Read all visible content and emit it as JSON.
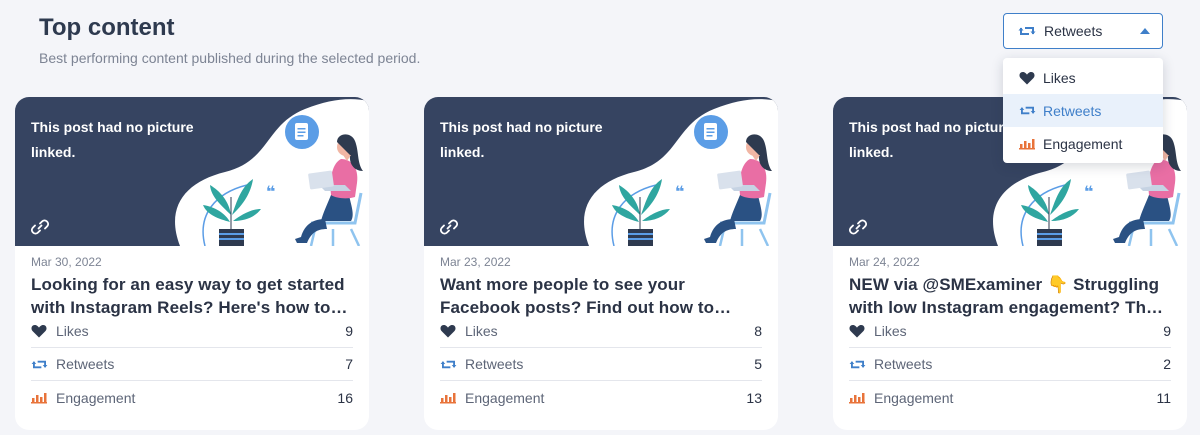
{
  "header": {
    "title": "Top content",
    "subtitle": "Best performing content published during the selected period."
  },
  "metric_select": {
    "selected": "Retweets",
    "options": [
      {
        "label": "Likes",
        "icon": "heart-icon"
      },
      {
        "label": "Retweets",
        "icon": "retweet-icon"
      },
      {
        "label": "Engagement",
        "icon": "bar-chart-icon"
      }
    ]
  },
  "colors": {
    "banner": "#364461",
    "accent_blue": "#3f7fc9",
    "engagement_orange": "#e8733a",
    "heart_navy": "#2e3a4f"
  },
  "cards": [
    {
      "banner_text": "This post had no picture linked.",
      "date": "Mar 30, 2022",
      "title_line1": "Looking for an easy way to get started",
      "title_line2": "with Instagram Reels? Here's how to…",
      "stats": [
        {
          "label": "Likes",
          "value": "9",
          "icon": "heart-icon"
        },
        {
          "label": "Retweets",
          "value": "7",
          "icon": "retweet-icon"
        },
        {
          "label": "Engagement",
          "value": "16",
          "icon": "bar-chart-icon"
        }
      ]
    },
    {
      "banner_text": "This post had no picture linked.",
      "date": "Mar 23, 2022",
      "title_line1": "Want more people to see your",
      "title_line2": "Facebook posts? Find out how to…",
      "stats": [
        {
          "label": "Likes",
          "value": "8",
          "icon": "heart-icon"
        },
        {
          "label": "Retweets",
          "value": "5",
          "icon": "retweet-icon"
        },
        {
          "label": "Engagement",
          "value": "13",
          "icon": "bar-chart-icon"
        }
      ]
    },
    {
      "banner_text": "This post had no picture linked.",
      "date": "Mar 24, 2022",
      "title_line1": "NEW via @SMExaminer 👇 Struggling",
      "title_line2": "with low Instagram engagement? Th…",
      "stats": [
        {
          "label": "Likes",
          "value": "9",
          "icon": "heart-icon"
        },
        {
          "label": "Retweets",
          "value": "2",
          "icon": "retweet-icon"
        },
        {
          "label": "Engagement",
          "value": "11",
          "icon": "bar-chart-icon"
        }
      ]
    }
  ]
}
